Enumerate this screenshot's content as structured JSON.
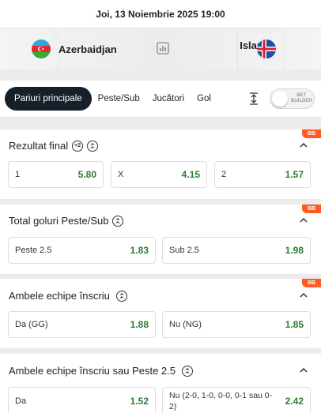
{
  "header": {
    "datetime": "Joi, 13 Noiembrie 2025 19:00",
    "home_team": "Azerbaidjan",
    "away_team": "Islanda"
  },
  "tabs": [
    {
      "label": "Pariuri principale",
      "active": true
    },
    {
      "label": "Peste/Sub",
      "active": false
    },
    {
      "label": "Jucători",
      "active": false
    },
    {
      "label": "Gol",
      "active": false
    }
  ],
  "bet_builder_toggle": {
    "label_line1": "BET",
    "label_line2": "BUILDER",
    "on": false
  },
  "markets": [
    {
      "title": "Rezultat final",
      "badge": "BB",
      "outcomes": [
        {
          "label": "1",
          "odd": "5.80"
        },
        {
          "label": "X",
          "odd": "4.15"
        },
        {
          "label": "2",
          "odd": "1.57"
        }
      ]
    },
    {
      "title": "Total goluri Peste/Sub",
      "badge": "BB",
      "outcomes": [
        {
          "label": "Peste 2.5",
          "odd": "1.83"
        },
        {
          "label": "Sub 2.5",
          "odd": "1.98"
        }
      ]
    },
    {
      "title": "Ambele echipe înscriu",
      "badge": "BB",
      "outcomes": [
        {
          "label": "Da (GG)",
          "odd": "1.88"
        },
        {
          "label": "Nu (NG)",
          "odd": "1.85"
        }
      ]
    },
    {
      "title": "Ambele echipe înscriu sau Peste 2.5",
      "badge": "",
      "outcomes": [
        {
          "label": "Da",
          "odd": "1.52"
        },
        {
          "label": "Nu (2-0, 1-0, 0-0, 0-1 sau 0-2)",
          "odd": "2.42"
        }
      ]
    }
  ],
  "badges": {
    "plus2": "+2"
  },
  "colors": {
    "odd_value": "#2e7d32",
    "bb_badge": "#ff5a1f",
    "active_tab": "#15202b"
  },
  "icons": [
    "stats-icon",
    "bet-builder-icon",
    "filter-icon",
    "chevron-up-icon"
  ]
}
